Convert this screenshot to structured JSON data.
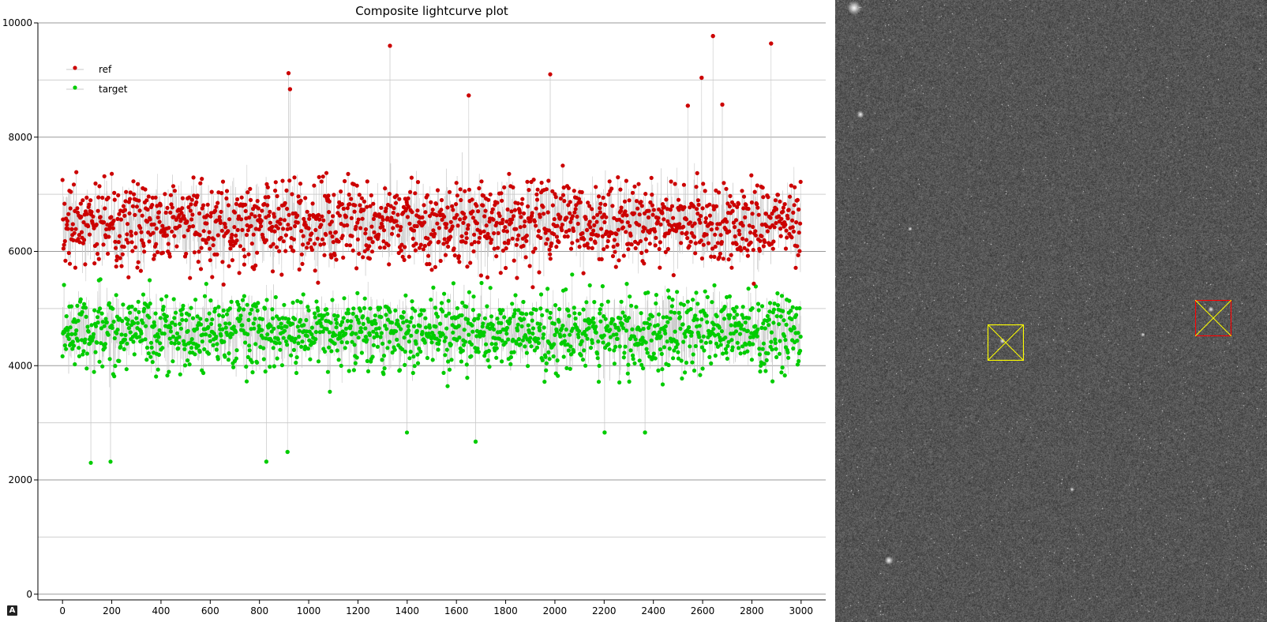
{
  "chart_data": {
    "type": "scatter",
    "title": "Composite lightcurve plot",
    "xlabel": "",
    "ylabel": "",
    "xlim": [
      -100,
      3100
    ],
    "ylim": [
      -100,
      10000
    ],
    "x_ticks": [
      "0",
      "200",
      "400",
      "600",
      "800",
      "1000",
      "1200",
      "1400",
      "1600",
      "1800",
      "2000",
      "2200",
      "2400",
      "2600",
      "2800",
      "3000"
    ],
    "y_ticks": [
      "0",
      "2000",
      "4000",
      "6000",
      "8000",
      "10000"
    ],
    "grid": true,
    "legend_position": "top-left",
    "n_points": 3000,
    "series": [
      {
        "name": "ref",
        "color": "#cc0000",
        "mean": 6500,
        "spread": 600,
        "peaks": [
          [
            1330,
            9600
          ],
          [
            918,
            9120
          ],
          [
            924,
            8840
          ],
          [
            2642,
            9770
          ],
          [
            2878,
            9640
          ],
          [
            1981,
            9100
          ],
          [
            2596,
            9040
          ],
          [
            1650,
            8730
          ],
          [
            2680,
            8570
          ],
          [
            2540,
            8550
          ]
        ]
      },
      {
        "name": "target",
        "color": "#00cc00",
        "mean": 4600,
        "spread": 550,
        "dips": [
          [
            115,
            2300
          ],
          [
            195,
            2320
          ],
          [
            828,
            2320
          ],
          [
            914,
            2490
          ],
          [
            1678,
            2670
          ],
          [
            2366,
            2830
          ],
          [
            2202,
            2830
          ],
          [
            1399,
            2830
          ]
        ]
      }
    ]
  },
  "image_view": {
    "background": "#3a3a3a",
    "markers": [
      {
        "name": "target",
        "color": "#ffff00"
      },
      {
        "name": "ref",
        "color": "#ff0000"
      }
    ]
  },
  "ui": {
    "autoscale_glyph": "A"
  }
}
